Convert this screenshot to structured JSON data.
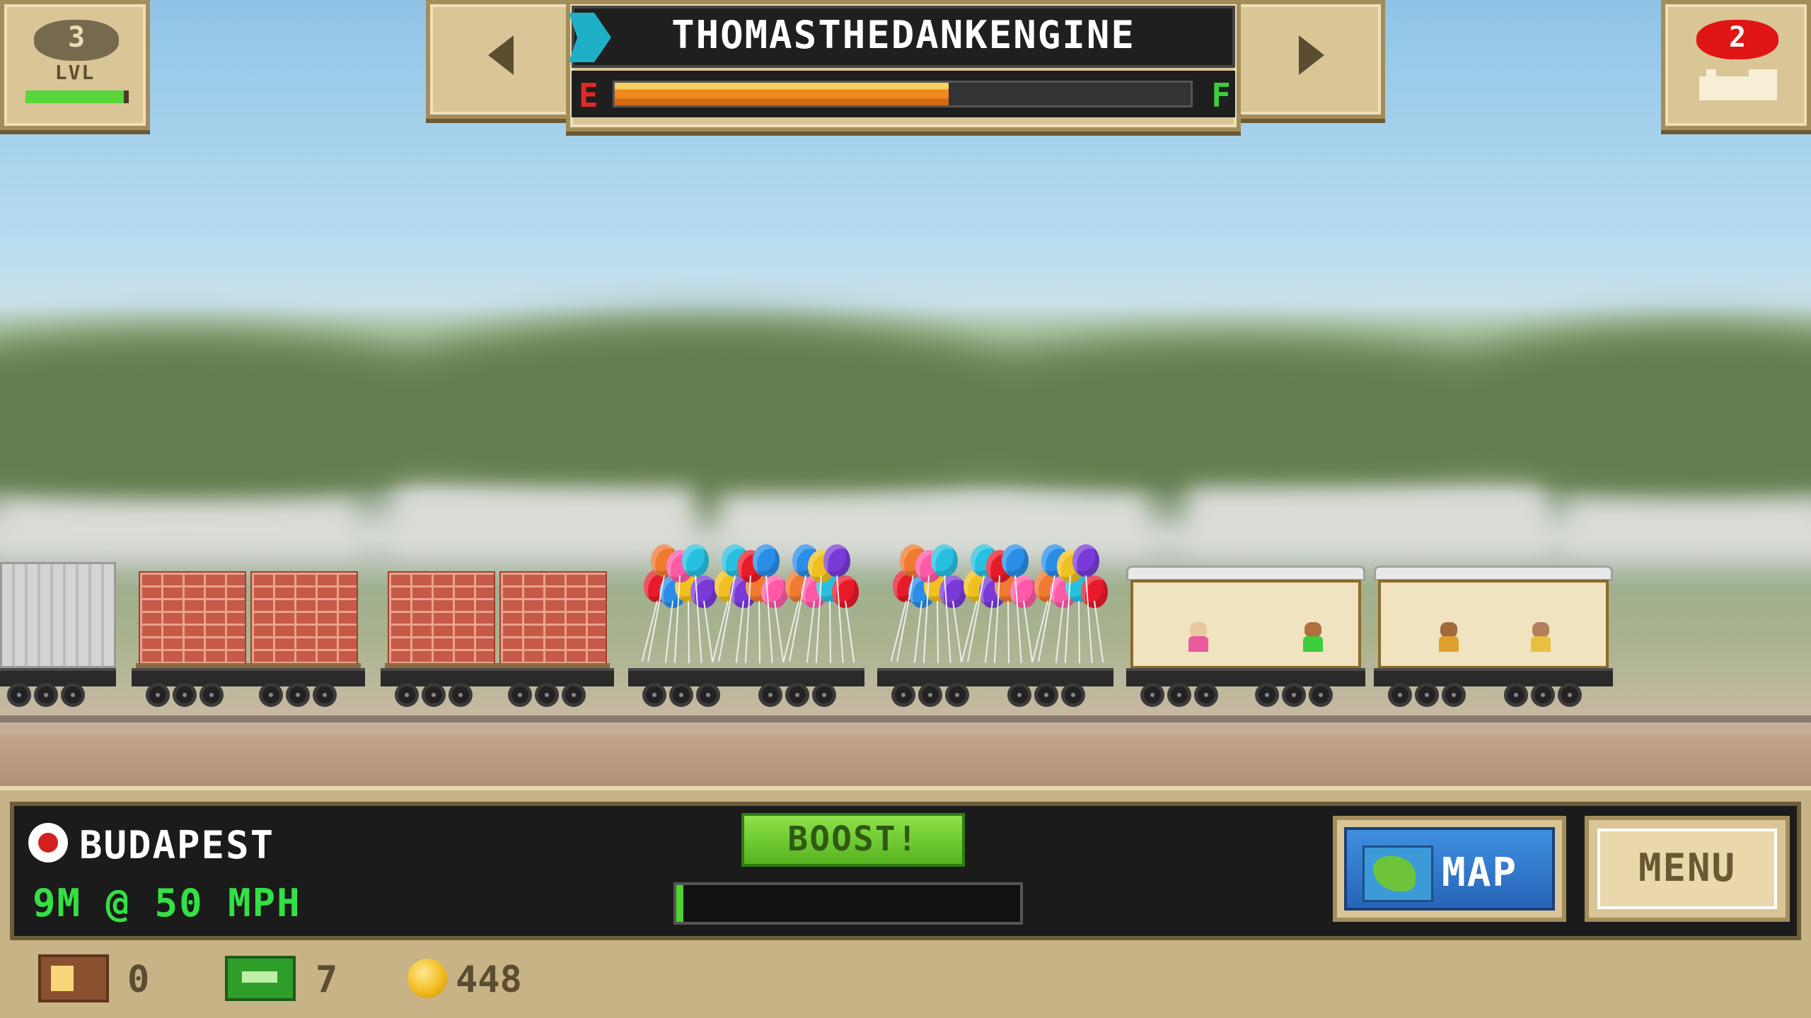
{
  "hud": {
    "level": "3",
    "level_label": "LVL",
    "level_progress": 0.95,
    "train_name": "THOMASTHEDANKENGINE",
    "fuel_empty_label": "E",
    "fuel_full_label": "F",
    "fuel_level": 0.58,
    "notification_count": "2"
  },
  "status": {
    "station": "BUDAPEST",
    "speed_text": "9M @ 50 MPH",
    "boost_label": "BOOST!",
    "boost_progress": 0.02
  },
  "buttons": {
    "map_label": "MAP",
    "menu_label": "MENU"
  },
  "resources": {
    "crates": "0",
    "cash": "7",
    "coins": "448"
  },
  "colors": {
    "panel_tan": "#d9c596",
    "boost_green": "#56b320",
    "speed_green": "#34e045",
    "notif_red": "#e01515",
    "map_blue": "#2f7ad0"
  }
}
